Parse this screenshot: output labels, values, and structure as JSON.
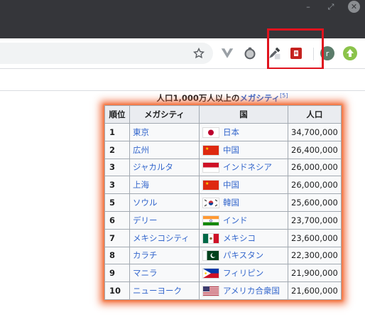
{
  "window": {
    "minimize": "–",
    "restore": "⤢",
    "close": "✕"
  },
  "toolbar": {
    "icons": [
      "star-icon",
      "vue-devtools-icon",
      "tampermonkey-icon",
      "eyedropper-icon",
      "pdf-extension-icon",
      "profile-avatar-icon",
      "upload-icon"
    ],
    "avatar_letter": "r",
    "highlight_color": "#e0131e"
  },
  "caption": {
    "prefix": "人口1,000万人以上の",
    "link": "メガシティ",
    "ref": "[5]"
  },
  "table": {
    "headers": [
      "順位",
      "メガシティ",
      "国",
      "人口"
    ],
    "rows": [
      {
        "rank": "1",
        "city": "東京",
        "country": "日本",
        "flag": "japan",
        "population": "34,700,000"
      },
      {
        "rank": "2",
        "city": "広州",
        "country": "中国",
        "flag": "china",
        "population": "26,400,000"
      },
      {
        "rank": "3",
        "city": "ジャカルタ",
        "country": "インドネシア",
        "flag": "indonesia",
        "population": "26,000,000"
      },
      {
        "rank": "3",
        "city": "上海",
        "country": "中国",
        "flag": "china",
        "population": "26,000,000"
      },
      {
        "rank": "5",
        "city": "ソウル",
        "country": "韓国",
        "flag": "korea",
        "population": "25,600,000"
      },
      {
        "rank": "6",
        "city": "デリー",
        "country": "インド",
        "flag": "india",
        "population": "23,700,000"
      },
      {
        "rank": "7",
        "city": "メキシコシティ",
        "country": "メキシコ",
        "flag": "mexico",
        "population": "23,600,000"
      },
      {
        "rank": "8",
        "city": "カラチ",
        "country": "パキスタン",
        "flag": "pakistan",
        "population": "22,300,000"
      },
      {
        "rank": "9",
        "city": "マニラ",
        "country": "フィリピン",
        "flag": "philippines",
        "population": "21,900,000"
      },
      {
        "rank": "10",
        "city": "ニューヨーク",
        "country": "アメリカ合衆国",
        "flag": "usa",
        "population": "21,600,000"
      }
    ]
  }
}
